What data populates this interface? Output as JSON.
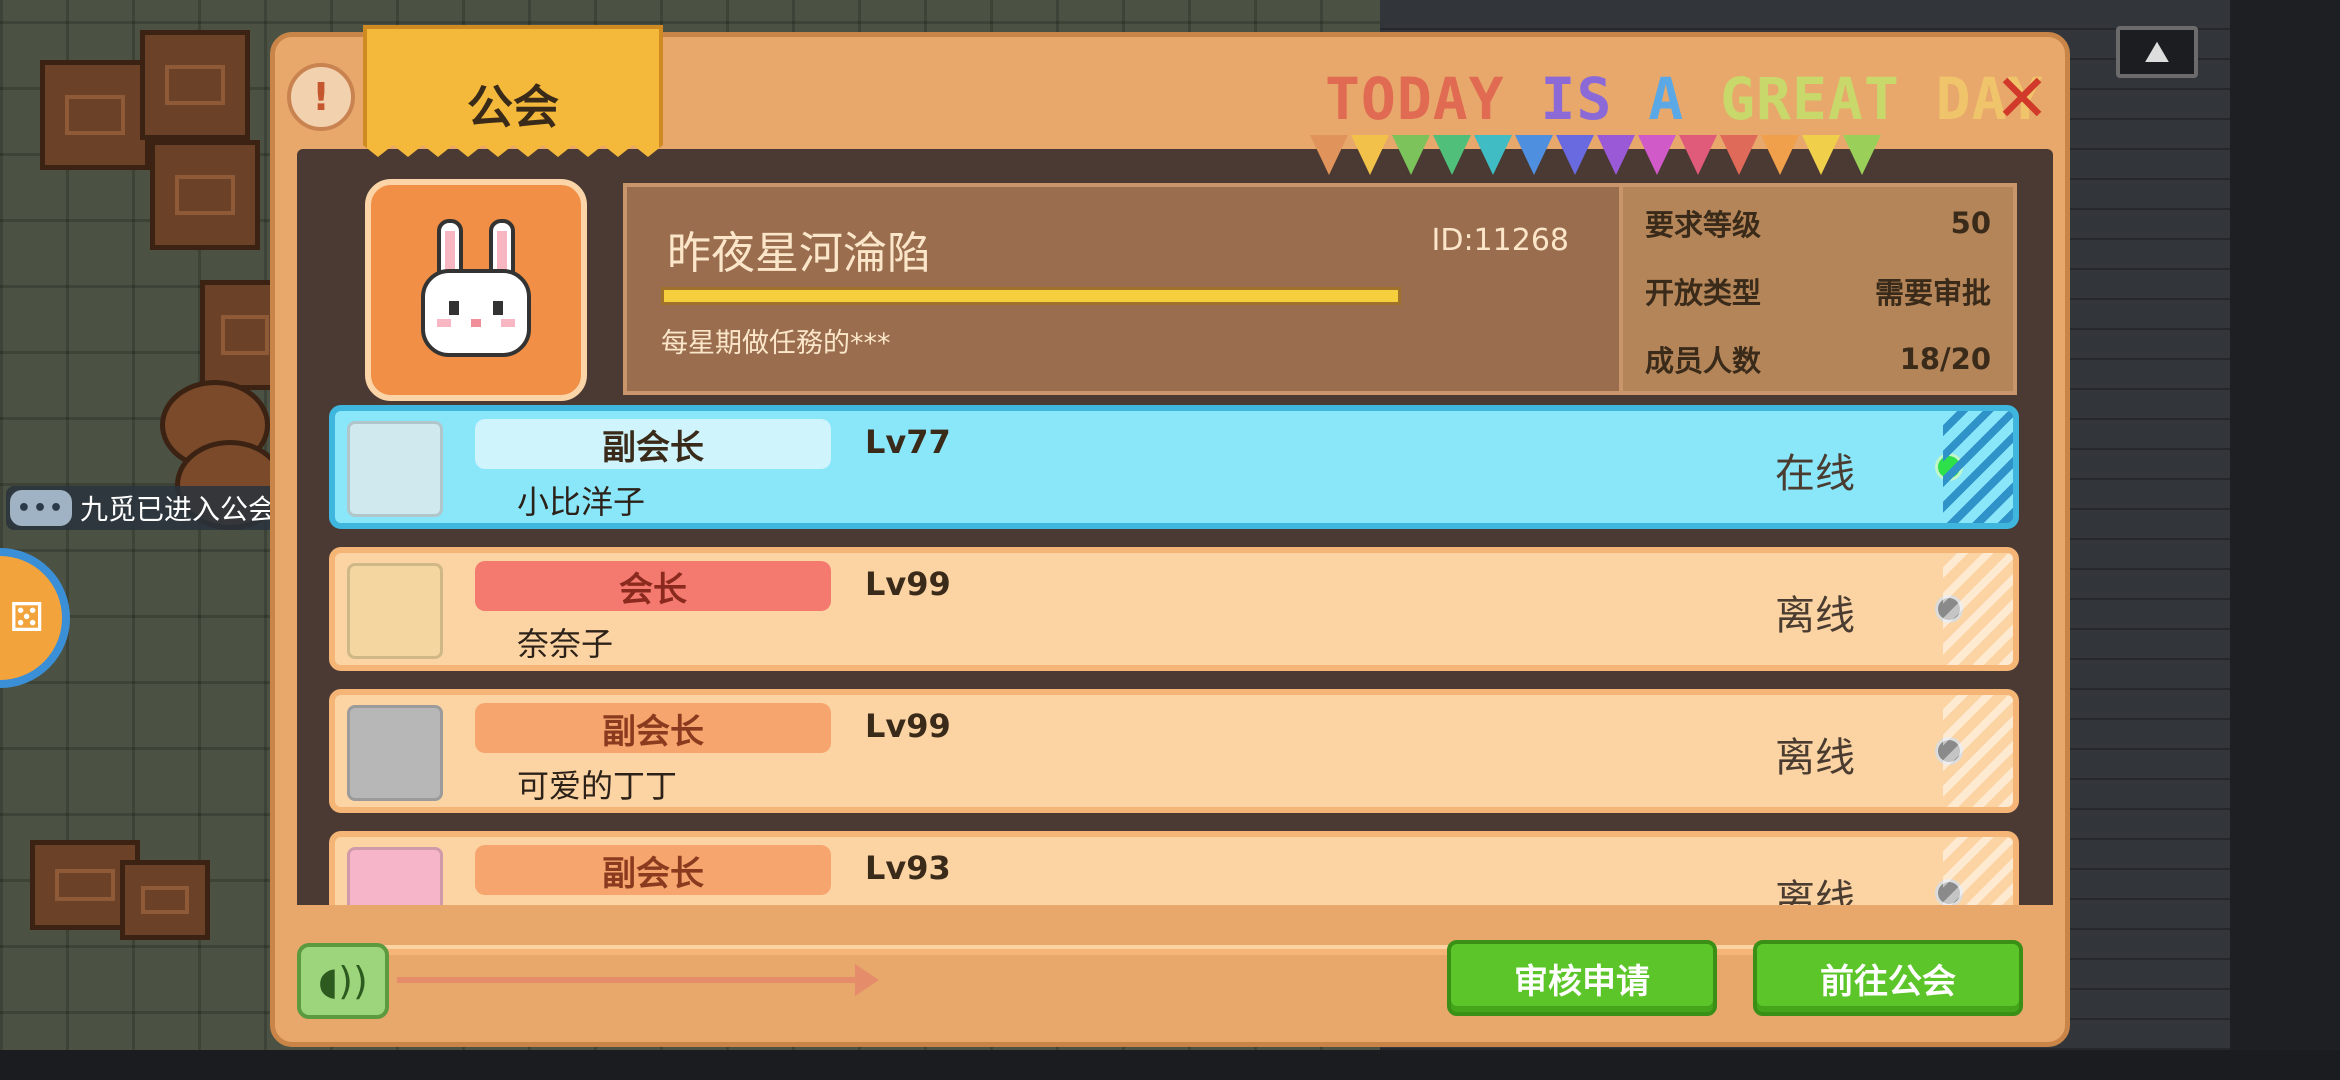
{
  "scene": {
    "chat_bubble_text": "九觅已进入公会",
    "chat_icon": "chat-dots-icon"
  },
  "panel": {
    "title": "公会",
    "banner": [
      {
        "text": "TODAY",
        "color": "#e06a52"
      },
      {
        "text": " ",
        "color": "#ffffff"
      },
      {
        "text": "IS",
        "color": "#8b6ad8"
      },
      {
        "text": " ",
        "color": "#ffffff"
      },
      {
        "text": "A",
        "color": "#5aa9e6"
      },
      {
        "text": " ",
        "color": "#ffffff"
      },
      {
        "text": "GREAT",
        "color": "#c8d86a"
      },
      {
        "text": " ",
        "color": "#ffffff"
      },
      {
        "text": "DAY",
        "color": "#f0c46a"
      }
    ],
    "flag_colors": [
      "#e0935a",
      "#f2c14a",
      "#7cc35b",
      "#4fbf7a",
      "#3fbcc4",
      "#4f8fe0",
      "#6a6ae0",
      "#9a5ad8",
      "#d05ac8",
      "#e05a7a",
      "#e06a5a",
      "#f0a04a",
      "#f0d04a",
      "#9ad05a"
    ]
  },
  "guild": {
    "name": "昨夜星河淪陷",
    "id": "ID:11268",
    "description": "每星期做任務的***",
    "requirements": [
      {
        "label": "要求等级",
        "value": "50"
      },
      {
        "label": "开放类型",
        "value": "需要审批"
      },
      {
        "label": "成员人数",
        "value": "18/20"
      }
    ]
  },
  "members": [
    {
      "role": "副会长",
      "level": "Lv77",
      "name": "小比洋子",
      "status": "在线",
      "online": true,
      "role_color": "#cff4fb",
      "role_text": "#3a2a1a",
      "avatar": "#cfe9ef"
    },
    {
      "role": "会长",
      "level": "Lv99",
      "name": "奈奈子",
      "status": "离线",
      "online": false,
      "role_color": "#f47a70",
      "role_text": "#8a2a1e",
      "avatar": "#f4d7a0"
    },
    {
      "role": "副会长",
      "level": "Lv99",
      "name": "可爱的丁丁",
      "status": "离线",
      "online": false,
      "role_color": "#f7a56e",
      "role_text": "#8a3a1e",
      "avatar": "#b7b7b7"
    },
    {
      "role": "副会长",
      "level": "Lv93",
      "name": "",
      "status": "离线",
      "online": false,
      "role_color": "#f7a56e",
      "role_text": "#8a3a1e",
      "avatar": "#f6b5c9"
    }
  ],
  "colors": {
    "online_dot": "#2ee04a",
    "offline_dot": "#8a8a8a"
  },
  "footer": {
    "review_button": "审核申请",
    "goto_button": "前往公会",
    "voice_icon": "voice-speaker-icon"
  }
}
